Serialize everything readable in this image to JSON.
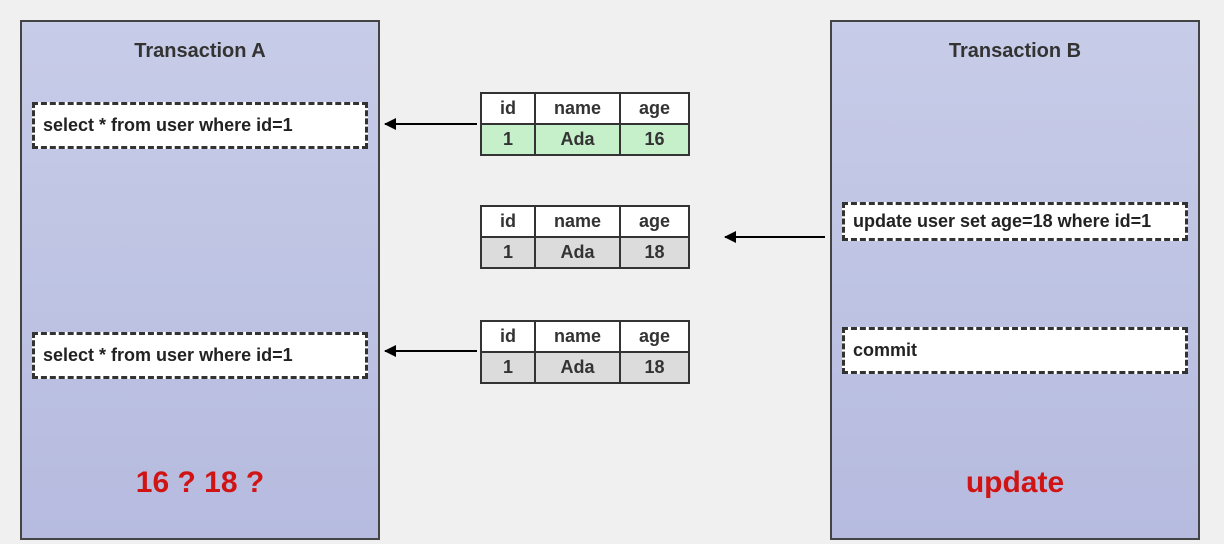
{
  "transactionA": {
    "title": "Transaction A",
    "query1": "select * from user where id=1",
    "query2": "select * from user where id=1",
    "question": "16  ?  18  ?"
  },
  "transactionB": {
    "title": "Transaction B",
    "update": "update user set age=18 where id=1",
    "commit": "commit",
    "label": "update"
  },
  "tables": {
    "headers": {
      "id": "id",
      "name": "name",
      "age": "age"
    },
    "row1": {
      "id": "1",
      "name": "Ada",
      "age": "16"
    },
    "row2": {
      "id": "1",
      "name": "Ada",
      "age": "18"
    },
    "row3": {
      "id": "1",
      "name": "Ada",
      "age": "18"
    }
  }
}
